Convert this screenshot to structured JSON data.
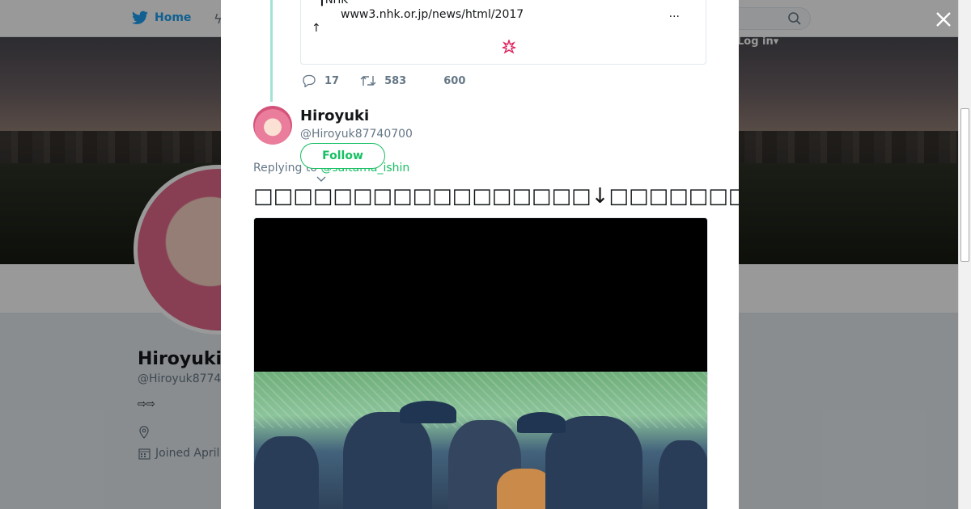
{
  "topnav": {
    "home_label": "Home",
    "login_label": "Log in"
  },
  "profile": {
    "name": "Hiroyuki",
    "handle": "@Hiroyuk8774",
    "bio": "⇨⇨",
    "joined": "Joined April"
  },
  "modal": {
    "quote": {
      "source": "NHK",
      "url": "www3.nhk.or.jp/news/html/2017",
      "more": "...",
      "arrow": "↑"
    },
    "actions": {
      "replies": "17",
      "retweets": "583",
      "likes": "600"
    },
    "reply": {
      "name": "Hiroyuki",
      "handle": "@Hiroyuk87740700",
      "follow_label": "Follow",
      "replying_prefix": "Replying to ",
      "replying_to": "@saitama_ishin",
      "text": "□□□□□□□□□□□□□□□□□↓□□□□□□□□□□"
    }
  },
  "colors": {
    "brand": "#1da1f2",
    "follow": "#17bf63",
    "thread_line": "#a3e3d6",
    "anger_icon": "#e0245e"
  }
}
